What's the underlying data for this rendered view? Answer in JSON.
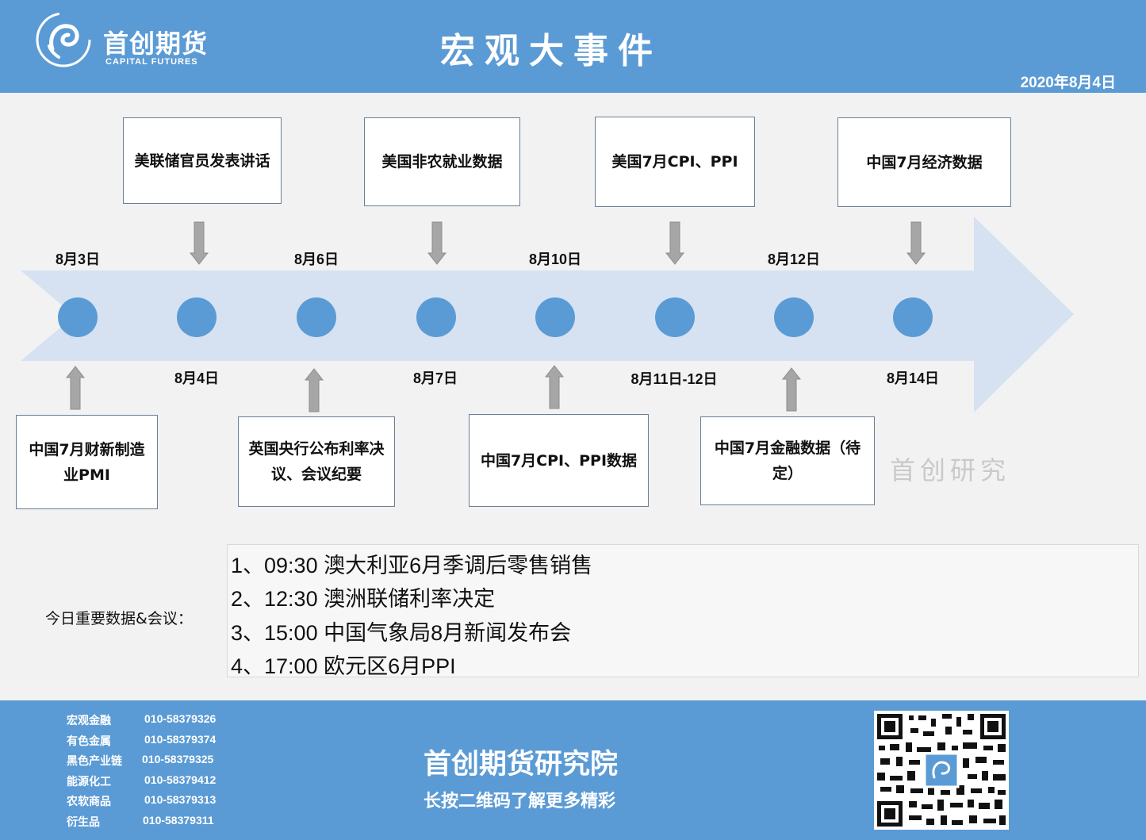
{
  "header": {
    "brand_cn": "首创期货",
    "brand_en": "CAPITAL FUTURES",
    "title": "宏观大事件",
    "date": "2020年8月4日"
  },
  "timeline": {
    "top_dates": [
      "8月3日",
      "8月6日",
      "8月10日",
      "8月12日"
    ],
    "bottom_dates": [
      "8月4日",
      "8月7日",
      "8月11日-12日",
      "8月14日"
    ],
    "top_events": [
      "美联储官员发表讲话",
      "美国非农就业数据",
      "美国7月CPI、PPI",
      "中国7月经济数据"
    ],
    "bottom_events": [
      "中国7月财新制造业PMI",
      "英国央行公布利率决议、会议纪要",
      "中国7月CPI、PPI数据",
      "中国7月金融数据（待定）"
    ]
  },
  "watermark": "首创研究",
  "today": {
    "label": "今日重要数据&会议：",
    "items": [
      "1、09:30 澳大利亚6月季调后零售销售",
      "2、12:30 澳洲联储利率决定",
      "3、15:00 中国气象局8月新闻发布会",
      "4、17:00 欧元区6月PPI"
    ]
  },
  "footer": {
    "contacts": [
      {
        "name": "宏观金融",
        "phone": "010-58379326"
      },
      {
        "name": "有色金属",
        "phone": "010-58379374"
      },
      {
        "name": "黑色产业链",
        "phone": "010-58379325"
      },
      {
        "name": "能源化工",
        "phone": "010-58379412"
      },
      {
        "name": "农软商品",
        "phone": "010-58379313"
      },
      {
        "name": "衍生品",
        "phone": "010-58379311"
      }
    ],
    "title": "首创期货研究院",
    "subtitle": "长按二维码了解更多精彩"
  },
  "colors": {
    "header": "#5b9bd5",
    "node": "#5b9bd5",
    "arrow": "#d6e2f1",
    "connector": "#a6a6a6"
  }
}
